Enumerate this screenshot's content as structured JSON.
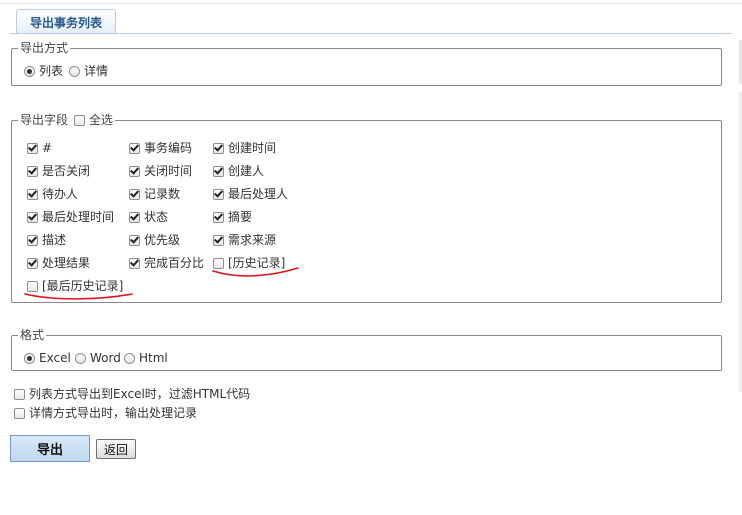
{
  "tab": {
    "label": "导出事务列表"
  },
  "export_mode": {
    "legend": "导出方式",
    "options": [
      {
        "label": "列表",
        "checked": true
      },
      {
        "label": "详情",
        "checked": false
      }
    ]
  },
  "fields": {
    "legend": "导出字段",
    "select_all": {
      "label": "全选",
      "checked": false
    },
    "items": [
      {
        "label": "#",
        "checked": true
      },
      {
        "label": "事务编码",
        "checked": true
      },
      {
        "label": "创建时间",
        "checked": true
      },
      {
        "label": "是否关闭",
        "checked": true
      },
      {
        "label": "关闭时间",
        "checked": true
      },
      {
        "label": "创建人",
        "checked": true
      },
      {
        "label": "待办人",
        "checked": true
      },
      {
        "label": "记录数",
        "checked": true
      },
      {
        "label": "最后处理人",
        "checked": true
      },
      {
        "label": "最后处理时间",
        "checked": true
      },
      {
        "label": "状态",
        "checked": true
      },
      {
        "label": "摘要",
        "checked": true
      },
      {
        "label": "描述",
        "checked": true
      },
      {
        "label": "优先级",
        "checked": true
      },
      {
        "label": "需求来源",
        "checked": true
      },
      {
        "label": "处理结果",
        "checked": true
      },
      {
        "label": "完成百分比",
        "checked": true
      },
      {
        "label": "[历史记录]",
        "checked": false
      },
      {
        "label": "[最后历史记录]",
        "checked": false
      }
    ]
  },
  "format": {
    "legend": "格式",
    "options": [
      {
        "label": "Excel",
        "checked": true
      },
      {
        "label": "Word",
        "checked": false
      },
      {
        "label": "Html",
        "checked": false
      }
    ]
  },
  "extra_options": [
    {
      "label": "列表方式导出到Excel时，过滤HTML代码",
      "checked": false
    },
    {
      "label": "详情方式导出时，输出处理记录",
      "checked": false
    }
  ],
  "buttons": {
    "export": "导出",
    "back": "返回"
  },
  "annotation_color": "#e0141c"
}
